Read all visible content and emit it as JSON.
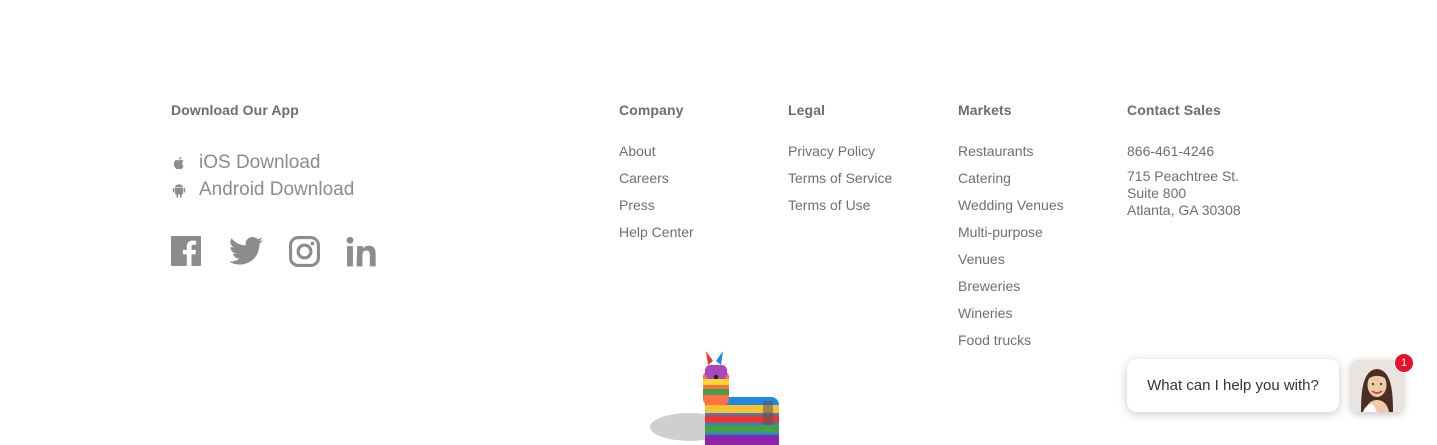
{
  "download_app": {
    "heading": "Download Our App",
    "ios_label": "iOS Download",
    "android_label": "Android Download"
  },
  "social": {
    "icons": [
      "facebook-icon",
      "twitter-icon",
      "instagram-icon",
      "linkedin-icon"
    ]
  },
  "company": {
    "heading": "Company",
    "items": [
      "About",
      "Careers",
      "Press",
      "Help Center"
    ]
  },
  "legal": {
    "heading": "Legal",
    "items": [
      "Privacy Policy",
      "Terms of Service",
      "Terms of Use"
    ]
  },
  "markets": {
    "heading": "Markets",
    "items": [
      "Restaurants",
      "Catering",
      "Wedding Venues",
      "Multi-purpose",
      "Venues",
      "Breweries",
      "Wineries",
      "Food trucks"
    ]
  },
  "contact": {
    "heading": "Contact Sales",
    "phone": "866-461-4246",
    "address_line1": "715 Peachtree St.",
    "address_line2": "Suite 800",
    "address_line3": "Atlanta, GA 30308"
  },
  "chat": {
    "prompt": "What can I help you with?",
    "badge_count": "1"
  },
  "colors": {
    "text": "#6f6f6f",
    "icon_gray": "#8c8c8c",
    "badge_red": "#e8112d"
  }
}
